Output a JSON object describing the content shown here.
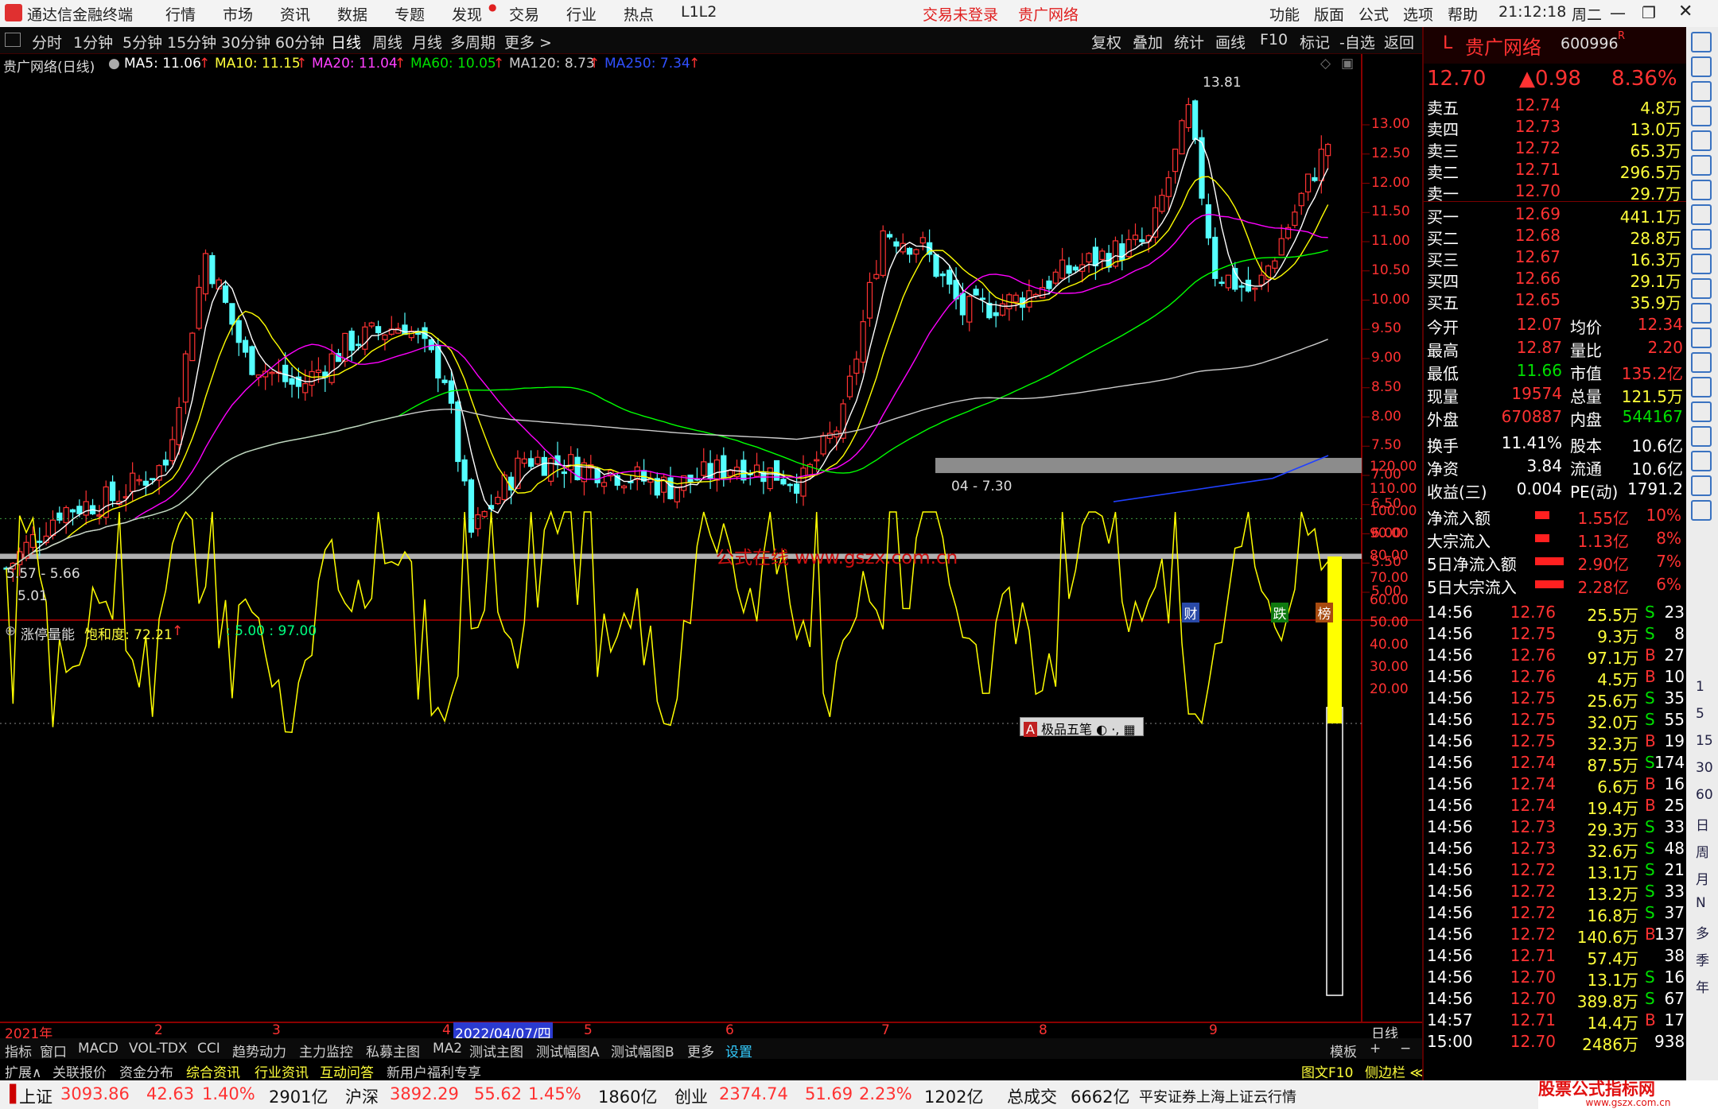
{
  "titlebar": {
    "app": "通达信金融终端",
    "menu": [
      "行情",
      "市场",
      "资讯",
      "数据",
      "专题",
      "发现",
      "交易",
      "行业",
      "热点",
      "L1L2"
    ],
    "login": "交易未登录",
    "stock_name": "贵广网络",
    "right_menu": [
      "功能",
      "版面",
      "公式",
      "选项",
      "帮助"
    ],
    "time": "21:12:18",
    "weekday": "周二"
  },
  "timeframes": [
    "分时",
    "1分钟",
    "5分钟",
    "15分钟",
    "30分钟",
    "60分钟",
    "日线",
    "周线",
    "月线",
    "多周期",
    "更多 >"
  ],
  "selected_timeframe": "日线",
  "tools": [
    "复权",
    "叠加",
    "统计",
    "画线",
    "F10",
    "标记",
    "-自选",
    "返回"
  ],
  "ma_header": {
    "title": "贵广网络(日线)",
    "ma5": "MA5: 11.06",
    "ma10": "MA10: 11.15",
    "ma20": "MA20: 11.04",
    "ma60": "MA60: 10.05",
    "ma120": "MA120: 8.73",
    "ma250": "MA250: 7.34"
  },
  "price_axis": [
    "13.00",
    "12.50",
    "12.00",
    "11.50",
    "11.00",
    "10.50",
    "10.00",
    "9.50",
    "9.00",
    "8.50",
    "8.00",
    "7.50",
    "7.00",
    "6.50",
    "6.00",
    "5.50",
    "5.00"
  ],
  "chart_labels": {
    "high": "13.81",
    "band1": "04 - 7.30",
    "band2": "5.57 - 5.66",
    "low": "5.01",
    "watermark": "公式在线  www.gszx.com.cn",
    "markers": [
      "财",
      "跌",
      "榜"
    ]
  },
  "indicator": {
    "name": "涨停量能",
    "saturation_label": "饱和度: 72.21",
    "params": ": 5.00 : 97.00",
    "axis": [
      "120.00",
      "110.00",
      "100.00",
      "90.00",
      "80.00",
      "70.00",
      "60.00",
      "50.00",
      "40.00",
      "30.00",
      "20.00"
    ],
    "popup": "极品五笔"
  },
  "date_axis": {
    "labels": [
      "2021年",
      "2",
      "3",
      "4",
      "2022/04/07/四",
      "5",
      "6",
      "7",
      "8",
      "9"
    ],
    "right": "日线"
  },
  "tabs_row1": [
    "指标",
    "窗口",
    "MACD",
    "VOL-TDX",
    "CCI",
    "趋势动力",
    "主力监控",
    "私募主图",
    "MA2",
    "测试主图",
    "测试幅图A",
    "测试幅图B",
    "更多",
    "设置"
  ],
  "tabs_row2": [
    "扩展∧",
    "关联报价",
    "资金分布",
    "综合资讯",
    "行业资讯",
    "互动问答",
    "新用户福利专享"
  ],
  "tabs_row2_right": [
    "图文F10",
    "侧边栏 ≪",
    "笔",
    "价",
    "细",
    "势"
  ],
  "quote": {
    "logo": "L",
    "name": "贵广网络",
    "code": "600996",
    "price": "12.70",
    "change": "▲0.98",
    "pct": "8.36%",
    "asks": [
      [
        "卖五",
        "12.74",
        "4.8万"
      ],
      [
        "卖四",
        "12.73",
        "13.0万"
      ],
      [
        "卖三",
        "12.72",
        "65.3万"
      ],
      [
        "卖二",
        "12.71",
        "296.5万"
      ],
      [
        "卖一",
        "12.70",
        "29.7万"
      ]
    ],
    "bids": [
      [
        "买一",
        "12.69",
        "441.1万"
      ],
      [
        "买二",
        "12.68",
        "28.8万"
      ],
      [
        "买三",
        "12.67",
        "16.3万"
      ],
      [
        "买四",
        "12.66",
        "29.1万"
      ],
      [
        "买五",
        "12.65",
        "35.9万"
      ]
    ],
    "stats": [
      [
        "今开",
        "12.07",
        "均价",
        "12.34"
      ],
      [
        "最高",
        "12.87",
        "量比",
        "2.20"
      ],
      [
        "最低",
        "11.66",
        "市值",
        "135.2亿"
      ],
      [
        "现量",
        "19574",
        "总量",
        "121.5万"
      ],
      [
        "外盘",
        "670887",
        "内盘",
        "544167"
      ]
    ],
    "stats2": [
      [
        "换手",
        "11.41%",
        "股本",
        "10.6亿"
      ],
      [
        "净资",
        "3.84",
        "流通",
        "10.6亿"
      ],
      [
        "收益(三)",
        "0.004",
        "PE(动)",
        "1791.2"
      ]
    ],
    "flows": [
      [
        "净流入额",
        "1.55亿",
        "10%"
      ],
      [
        "大宗流入",
        "1.13亿",
        "8%"
      ],
      [
        "5日净流入额",
        "2.90亿",
        "7%"
      ],
      [
        "5日大宗流入",
        "2.28亿",
        "6%"
      ]
    ],
    "ticks": [
      [
        "14:56",
        "12.76",
        "25.5万",
        "S",
        "23"
      ],
      [
        "14:56",
        "12.75",
        "9.3万",
        "S",
        "8"
      ],
      [
        "14:56",
        "12.76",
        "97.1万",
        "B",
        "27"
      ],
      [
        "14:56",
        "12.76",
        "4.5万",
        "B",
        "10"
      ],
      [
        "14:56",
        "12.75",
        "25.6万",
        "S",
        "35"
      ],
      [
        "14:56",
        "12.75",
        "32.0万",
        "S",
        "55"
      ],
      [
        "14:56",
        "12.75",
        "32.3万",
        "B",
        "19"
      ],
      [
        "14:56",
        "12.74",
        "87.5万",
        "S",
        "174"
      ],
      [
        "14:56",
        "12.74",
        "6.6万",
        "B",
        "16"
      ],
      [
        "14:56",
        "12.74",
        "19.4万",
        "B",
        "25"
      ],
      [
        "14:56",
        "12.73",
        "29.3万",
        "S",
        "33"
      ],
      [
        "14:56",
        "12.73",
        "32.6万",
        "S",
        "48"
      ],
      [
        "14:56",
        "12.72",
        "13.1万",
        "S",
        "21"
      ],
      [
        "14:56",
        "12.72",
        "13.2万",
        "S",
        "33"
      ],
      [
        "14:56",
        "12.72",
        "16.8万",
        "S",
        "37"
      ],
      [
        "14:56",
        "12.72",
        "140.6万",
        "B",
        "137"
      ],
      [
        "14:56",
        "12.71",
        "57.4万",
        "",
        "38"
      ],
      [
        "14:56",
        "12.70",
        "13.1万",
        "S",
        "16"
      ],
      [
        "14:56",
        "12.70",
        "389.8万",
        "S",
        "67"
      ],
      [
        "14:57",
        "12.71",
        "14.4万",
        "B",
        "17"
      ],
      [
        "15:00",
        "12.70",
        "2486万",
        "",
        "938"
      ]
    ]
  },
  "sidebar_labels": [
    "1",
    "5",
    "15",
    "30",
    "60",
    "日",
    "周",
    "月",
    "N",
    "多",
    "季",
    "年"
  ],
  "statusbar": {
    "sh": [
      "上证",
      "3093.86",
      "42.63",
      "1.40%",
      "2901亿"
    ],
    "sz": [
      "沪深",
      "3892.29",
      "55.62",
      "1.45%",
      "1860亿"
    ],
    "cy": [
      "创业",
      "2374.74",
      "51.69",
      "2.23%",
      "1202亿"
    ],
    "total": [
      "总成交",
      "6662亿"
    ],
    "broker": "平安证券上海上证云行情",
    "brand": "股票公式指标网",
    "brand_url": "www.gszx.com.cn"
  },
  "colors": {
    "up": "#ff3232",
    "down": "#54ffff",
    "ma5": "#ffffff",
    "ma10": "#ffff00",
    "ma20": "#ff00ff",
    "ma60": "#00ff00",
    "ma120": "#cccccc",
    "ma250": "#2040ff"
  }
}
